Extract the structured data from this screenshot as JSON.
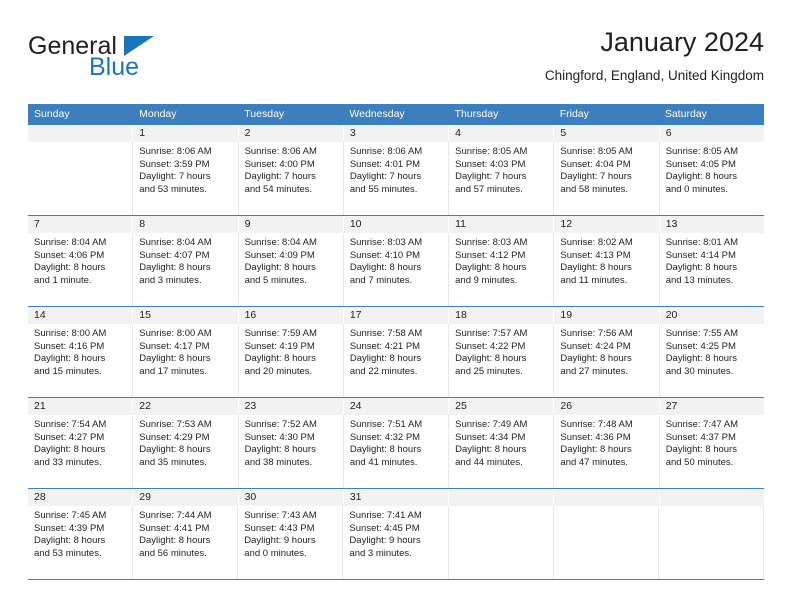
{
  "brand": {
    "name_part1": "General",
    "name_part2": "Blue",
    "triangle_icon": "triangle-icon",
    "colors": {
      "dark": "#231f20",
      "blue": "#1b75bb"
    }
  },
  "header": {
    "title": "January 2024",
    "subtitle": "Chingford, England, United Kingdom"
  },
  "calendar": {
    "header_bg": "#3d7ebd",
    "daynum_bg": "#f2f2f2",
    "weekday_headers": [
      "Sunday",
      "Monday",
      "Tuesday",
      "Wednesday",
      "Thursday",
      "Friday",
      "Saturday"
    ],
    "weeks": [
      [
        {
          "day": "",
          "sunrise": "",
          "sunset": "",
          "daylight_line1": "",
          "daylight_line2": ""
        },
        {
          "day": "1",
          "sunrise": "Sunrise: 8:06 AM",
          "sunset": "Sunset: 3:59 PM",
          "daylight_line1": "Daylight: 7 hours",
          "daylight_line2": "and 53 minutes."
        },
        {
          "day": "2",
          "sunrise": "Sunrise: 8:06 AM",
          "sunset": "Sunset: 4:00 PM",
          "daylight_line1": "Daylight: 7 hours",
          "daylight_line2": "and 54 minutes."
        },
        {
          "day": "3",
          "sunrise": "Sunrise: 8:06 AM",
          "sunset": "Sunset: 4:01 PM",
          "daylight_line1": "Daylight: 7 hours",
          "daylight_line2": "and 55 minutes."
        },
        {
          "day": "4",
          "sunrise": "Sunrise: 8:05 AM",
          "sunset": "Sunset: 4:03 PM",
          "daylight_line1": "Daylight: 7 hours",
          "daylight_line2": "and 57 minutes."
        },
        {
          "day": "5",
          "sunrise": "Sunrise: 8:05 AM",
          "sunset": "Sunset: 4:04 PM",
          "daylight_line1": "Daylight: 7 hours",
          "daylight_line2": "and 58 minutes."
        },
        {
          "day": "6",
          "sunrise": "Sunrise: 8:05 AM",
          "sunset": "Sunset: 4:05 PM",
          "daylight_line1": "Daylight: 8 hours",
          "daylight_line2": "and 0 minutes."
        }
      ],
      [
        {
          "day": "7",
          "sunrise": "Sunrise: 8:04 AM",
          "sunset": "Sunset: 4:06 PM",
          "daylight_line1": "Daylight: 8 hours",
          "daylight_line2": "and 1 minute."
        },
        {
          "day": "8",
          "sunrise": "Sunrise: 8:04 AM",
          "sunset": "Sunset: 4:07 PM",
          "daylight_line1": "Daylight: 8 hours",
          "daylight_line2": "and 3 minutes."
        },
        {
          "day": "9",
          "sunrise": "Sunrise: 8:04 AM",
          "sunset": "Sunset: 4:09 PM",
          "daylight_line1": "Daylight: 8 hours",
          "daylight_line2": "and 5 minutes."
        },
        {
          "day": "10",
          "sunrise": "Sunrise: 8:03 AM",
          "sunset": "Sunset: 4:10 PM",
          "daylight_line1": "Daylight: 8 hours",
          "daylight_line2": "and 7 minutes."
        },
        {
          "day": "11",
          "sunrise": "Sunrise: 8:03 AM",
          "sunset": "Sunset: 4:12 PM",
          "daylight_line1": "Daylight: 8 hours",
          "daylight_line2": "and 9 minutes."
        },
        {
          "day": "12",
          "sunrise": "Sunrise: 8:02 AM",
          "sunset": "Sunset: 4:13 PM",
          "daylight_line1": "Daylight: 8 hours",
          "daylight_line2": "and 11 minutes."
        },
        {
          "day": "13",
          "sunrise": "Sunrise: 8:01 AM",
          "sunset": "Sunset: 4:14 PM",
          "daylight_line1": "Daylight: 8 hours",
          "daylight_line2": "and 13 minutes."
        }
      ],
      [
        {
          "day": "14",
          "sunrise": "Sunrise: 8:00 AM",
          "sunset": "Sunset: 4:16 PM",
          "daylight_line1": "Daylight: 8 hours",
          "daylight_line2": "and 15 minutes."
        },
        {
          "day": "15",
          "sunrise": "Sunrise: 8:00 AM",
          "sunset": "Sunset: 4:17 PM",
          "daylight_line1": "Daylight: 8 hours",
          "daylight_line2": "and 17 minutes."
        },
        {
          "day": "16",
          "sunrise": "Sunrise: 7:59 AM",
          "sunset": "Sunset: 4:19 PM",
          "daylight_line1": "Daylight: 8 hours",
          "daylight_line2": "and 20 minutes."
        },
        {
          "day": "17",
          "sunrise": "Sunrise: 7:58 AM",
          "sunset": "Sunset: 4:21 PM",
          "daylight_line1": "Daylight: 8 hours",
          "daylight_line2": "and 22 minutes."
        },
        {
          "day": "18",
          "sunrise": "Sunrise: 7:57 AM",
          "sunset": "Sunset: 4:22 PM",
          "daylight_line1": "Daylight: 8 hours",
          "daylight_line2": "and 25 minutes."
        },
        {
          "day": "19",
          "sunrise": "Sunrise: 7:56 AM",
          "sunset": "Sunset: 4:24 PM",
          "daylight_line1": "Daylight: 8 hours",
          "daylight_line2": "and 27 minutes."
        },
        {
          "day": "20",
          "sunrise": "Sunrise: 7:55 AM",
          "sunset": "Sunset: 4:25 PM",
          "daylight_line1": "Daylight: 8 hours",
          "daylight_line2": "and 30 minutes."
        }
      ],
      [
        {
          "day": "21",
          "sunrise": "Sunrise: 7:54 AM",
          "sunset": "Sunset: 4:27 PM",
          "daylight_line1": "Daylight: 8 hours",
          "daylight_line2": "and 33 minutes."
        },
        {
          "day": "22",
          "sunrise": "Sunrise: 7:53 AM",
          "sunset": "Sunset: 4:29 PM",
          "daylight_line1": "Daylight: 8 hours",
          "daylight_line2": "and 35 minutes."
        },
        {
          "day": "23",
          "sunrise": "Sunrise: 7:52 AM",
          "sunset": "Sunset: 4:30 PM",
          "daylight_line1": "Daylight: 8 hours",
          "daylight_line2": "and 38 minutes."
        },
        {
          "day": "24",
          "sunrise": "Sunrise: 7:51 AM",
          "sunset": "Sunset: 4:32 PM",
          "daylight_line1": "Daylight: 8 hours",
          "daylight_line2": "and 41 minutes."
        },
        {
          "day": "25",
          "sunrise": "Sunrise: 7:49 AM",
          "sunset": "Sunset: 4:34 PM",
          "daylight_line1": "Daylight: 8 hours",
          "daylight_line2": "and 44 minutes."
        },
        {
          "day": "26",
          "sunrise": "Sunrise: 7:48 AM",
          "sunset": "Sunset: 4:36 PM",
          "daylight_line1": "Daylight: 8 hours",
          "daylight_line2": "and 47 minutes."
        },
        {
          "day": "27",
          "sunrise": "Sunrise: 7:47 AM",
          "sunset": "Sunset: 4:37 PM",
          "daylight_line1": "Daylight: 8 hours",
          "daylight_line2": "and 50 minutes."
        }
      ],
      [
        {
          "day": "28",
          "sunrise": "Sunrise: 7:45 AM",
          "sunset": "Sunset: 4:39 PM",
          "daylight_line1": "Daylight: 8 hours",
          "daylight_line2": "and 53 minutes."
        },
        {
          "day": "29",
          "sunrise": "Sunrise: 7:44 AM",
          "sunset": "Sunset: 4:41 PM",
          "daylight_line1": "Daylight: 8 hours",
          "daylight_line2": "and 56 minutes."
        },
        {
          "day": "30",
          "sunrise": "Sunrise: 7:43 AM",
          "sunset": "Sunset: 4:43 PM",
          "daylight_line1": "Daylight: 9 hours",
          "daylight_line2": "and 0 minutes."
        },
        {
          "day": "31",
          "sunrise": "Sunrise: 7:41 AM",
          "sunset": "Sunset: 4:45 PM",
          "daylight_line1": "Daylight: 9 hours",
          "daylight_line2": "and 3 minutes."
        },
        {
          "day": "",
          "sunrise": "",
          "sunset": "",
          "daylight_line1": "",
          "daylight_line2": ""
        },
        {
          "day": "",
          "sunrise": "",
          "sunset": "",
          "daylight_line1": "",
          "daylight_line2": ""
        },
        {
          "day": "",
          "sunrise": "",
          "sunset": "",
          "daylight_line1": "",
          "daylight_line2": ""
        }
      ]
    ]
  }
}
